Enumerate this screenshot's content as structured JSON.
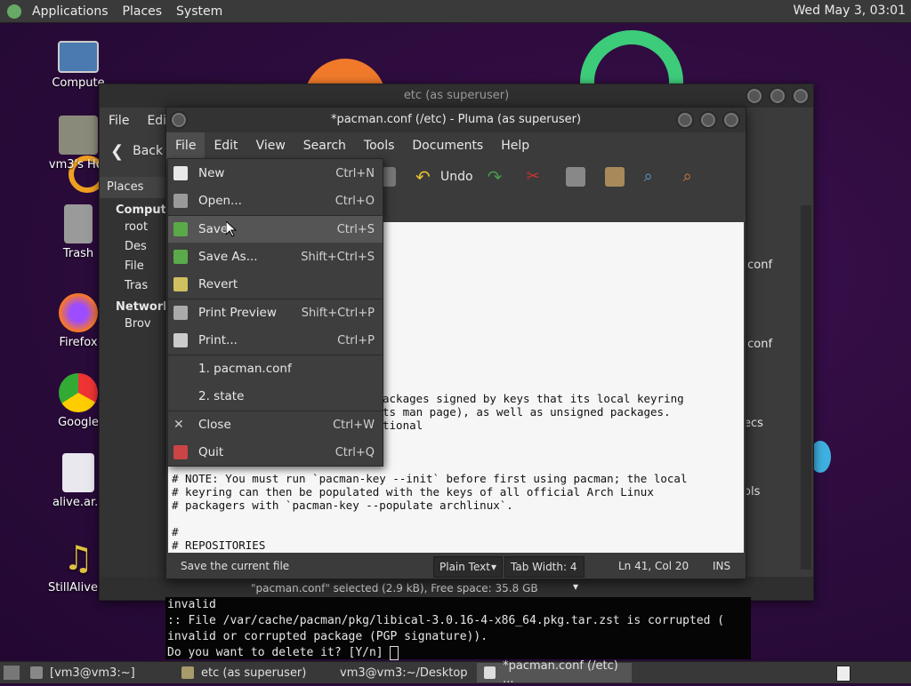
{
  "topbar": {
    "menus": [
      "Applications",
      "Places",
      "System"
    ],
    "clock": "Wed May 3, 03:01"
  },
  "desktop": {
    "icons": [
      "Compute",
      "vm3's Hor",
      "Trash",
      "Firefox",
      "Google",
      "alive.ar.s",
      "StillAlive.o"
    ]
  },
  "caja": {
    "title": "etc (as superuser)",
    "menus": [
      "File",
      "Edit"
    ],
    "back_label": "Back",
    "places_label": "Places",
    "computer_label": "Compute",
    "computer_items": [
      "root",
      "Des",
      "File",
      "Tras"
    ],
    "network_label": "Network",
    "network_items": [
      "Brov"
    ],
    "right_items": [
      ".conf",
      ".conf",
      "ecs",
      "ols"
    ],
    "status": "\"pacman.conf\" selected (2.9 kB), Free space: 35.8 GB"
  },
  "pluma": {
    "title": "*pacman.conf (/etc) - Pluma (as superuser)",
    "menus": [
      "File",
      "Edit",
      "View",
      "Search",
      "Tools",
      "Documents",
      "Help"
    ],
    "undo_label": "Undo",
    "editor_lines_top": [
      "ackages signed by keys that its local keyring",
      "ts man page), as well as unsigned packages.",
      "tional"
    ],
    "editor_lines_bottom": [
      "# NOTE: You must run `pacman-key --init` before first using pacman; the local",
      "# keyring can then be populated with the keys of all official Arch Linux",
      "# packagers with `pacman-key --populate archlinux`.",
      "",
      "#",
      "# REPOSITORIES"
    ],
    "status_text": "Save the current file",
    "syntax": "Plain Text",
    "tab_width": "Tab Width:  4",
    "position": "Ln 41, Col 20",
    "mode": "INS"
  },
  "file_menu": {
    "items": [
      {
        "label": "New",
        "accel": "Ctrl+N",
        "icon": "new-document-icon"
      },
      {
        "label": "Open...",
        "accel": "Ctrl+O",
        "icon": "folder-open-icon"
      },
      {
        "label": "Save",
        "accel": "Ctrl+S",
        "icon": "save-icon"
      },
      {
        "label": "Save As...",
        "accel": "Shift+Ctrl+S",
        "icon": "save-as-icon"
      },
      {
        "label": "Revert",
        "accel": "",
        "icon": "revert-icon"
      },
      {
        "label": "Print Preview",
        "accel": "Shift+Ctrl+P",
        "icon": "print-preview-icon"
      },
      {
        "label": "Print...",
        "accel": "Ctrl+P",
        "icon": "print-icon"
      },
      {
        "label": "1. pacman.conf",
        "accel": ""
      },
      {
        "label": "2. state",
        "accel": ""
      },
      {
        "label": "Close",
        "accel": "Ctrl+W",
        "icon": "close-icon"
      },
      {
        "label": "Quit",
        "accel": "Ctrl+Q",
        "icon": "quit-icon"
      }
    ],
    "highlighted": "Save"
  },
  "terminal": {
    "lines": [
      "invalid",
      ":: File /var/cache/pacman/pkg/libical-3.0.16-4-x86_64.pkg.tar.zst is corrupted (",
      "invalid or corrupted package (PGP signature)).",
      "Do you want to delete it? [Y/n] "
    ]
  },
  "taskbar": {
    "tasks": [
      "[vm3@vm3:~]",
      "etc (as superuser)",
      "vm3@vm3:~/Desktop",
      "*pacman.conf (/etc) ..."
    ]
  },
  "colors": {
    "accent": "#555555",
    "desktop_bg": "#2a0b3a"
  }
}
